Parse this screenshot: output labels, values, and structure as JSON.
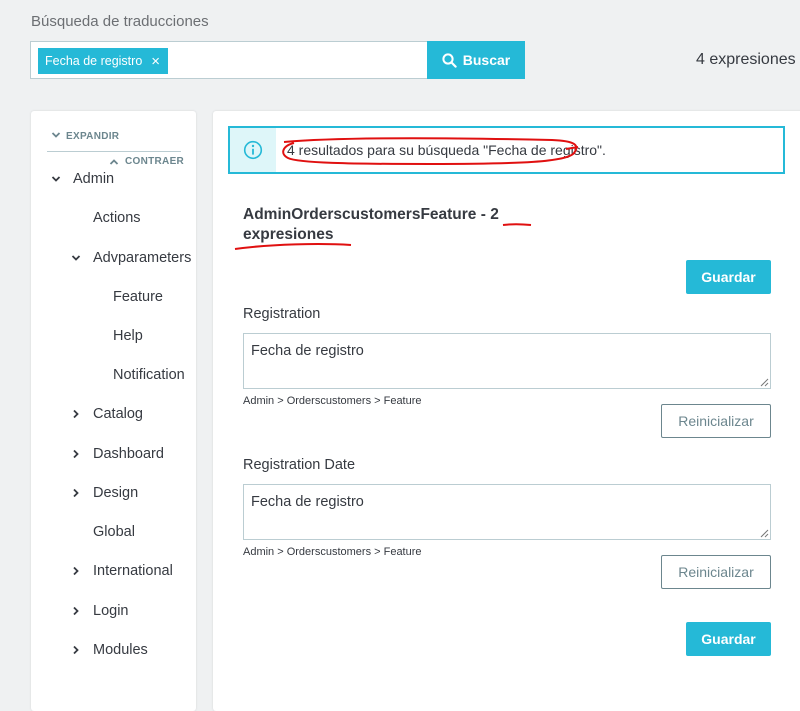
{
  "search": {
    "title": "Búsqueda de traducciones",
    "tag_label": "Fecha de registro",
    "tag_remove": "×",
    "button_label": "Buscar",
    "total_count": "4 expresiones"
  },
  "sidebar": {
    "expand_label": "EXPANDIR",
    "collapse_label": "CONTRAER",
    "items": [
      {
        "label": "Admin",
        "state": "expanded"
      },
      {
        "label": "Actions",
        "state": "leaf"
      },
      {
        "label": "Advparameters",
        "state": "expanded"
      },
      {
        "label": "Feature",
        "state": "leaf"
      },
      {
        "label": "Help",
        "state": "leaf"
      },
      {
        "label": "Notification",
        "state": "leaf"
      },
      {
        "label": "Catalog",
        "state": "collapsed"
      },
      {
        "label": "Dashboard",
        "state": "collapsed"
      },
      {
        "label": "Design",
        "state": "collapsed"
      },
      {
        "label": "Global",
        "state": "leaf"
      },
      {
        "label": "International",
        "state": "collapsed"
      },
      {
        "label": "Login",
        "state": "collapsed"
      },
      {
        "label": "Modules",
        "state": "collapsed"
      }
    ]
  },
  "alert": {
    "icon": "info-circle-icon",
    "text": "4 resultados para su búsqueda \"Fecha de registro\"."
  },
  "domain": {
    "title_name": "AdminOrderscustomersFeature - 2",
    "title_count": "expresiones",
    "save_label": "Guardar"
  },
  "translations": [
    {
      "label": "Registration",
      "value": "Fecha de registro",
      "path": "Admin > Orderscustomers > Feature",
      "reset_label": "Reinicializar"
    },
    {
      "label": "Registration Date",
      "value": "Fecha de registro",
      "path": "Admin > Orderscustomers > Feature",
      "reset_label": "Reinicializar"
    }
  ],
  "colors": {
    "accent": "#25b9d7",
    "annotation": "#e01010",
    "page_background": "#eff1f2",
    "text": "#363a41",
    "muted": "#6c868e"
  }
}
